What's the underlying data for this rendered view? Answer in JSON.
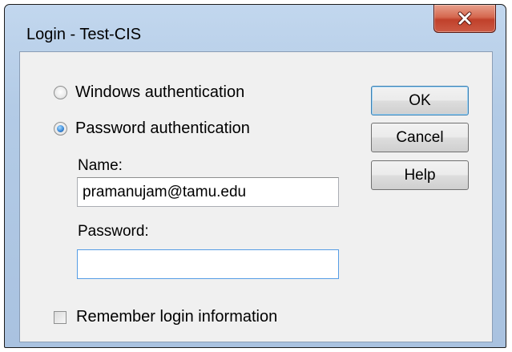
{
  "window": {
    "title": "Login - Test-CIS",
    "close_icon": "close-icon"
  },
  "auth": {
    "options": [
      {
        "label": "Windows authentication",
        "checked": false
      },
      {
        "label": "Password authentication",
        "checked": true
      }
    ]
  },
  "name": {
    "label": "Name:",
    "value": "pramanujam@tamu.edu"
  },
  "password": {
    "label": "Password:",
    "value": ""
  },
  "remember": {
    "label": "Remember login information",
    "checked": false
  },
  "buttons": {
    "ok": "OK",
    "cancel": "Cancel",
    "help": "Help"
  },
  "colors": {
    "title_bar": "#b3cbe6",
    "client_bg": "#f0f0f0",
    "close_button": "#c0402a",
    "radio_selected": "#3f8ddb"
  }
}
